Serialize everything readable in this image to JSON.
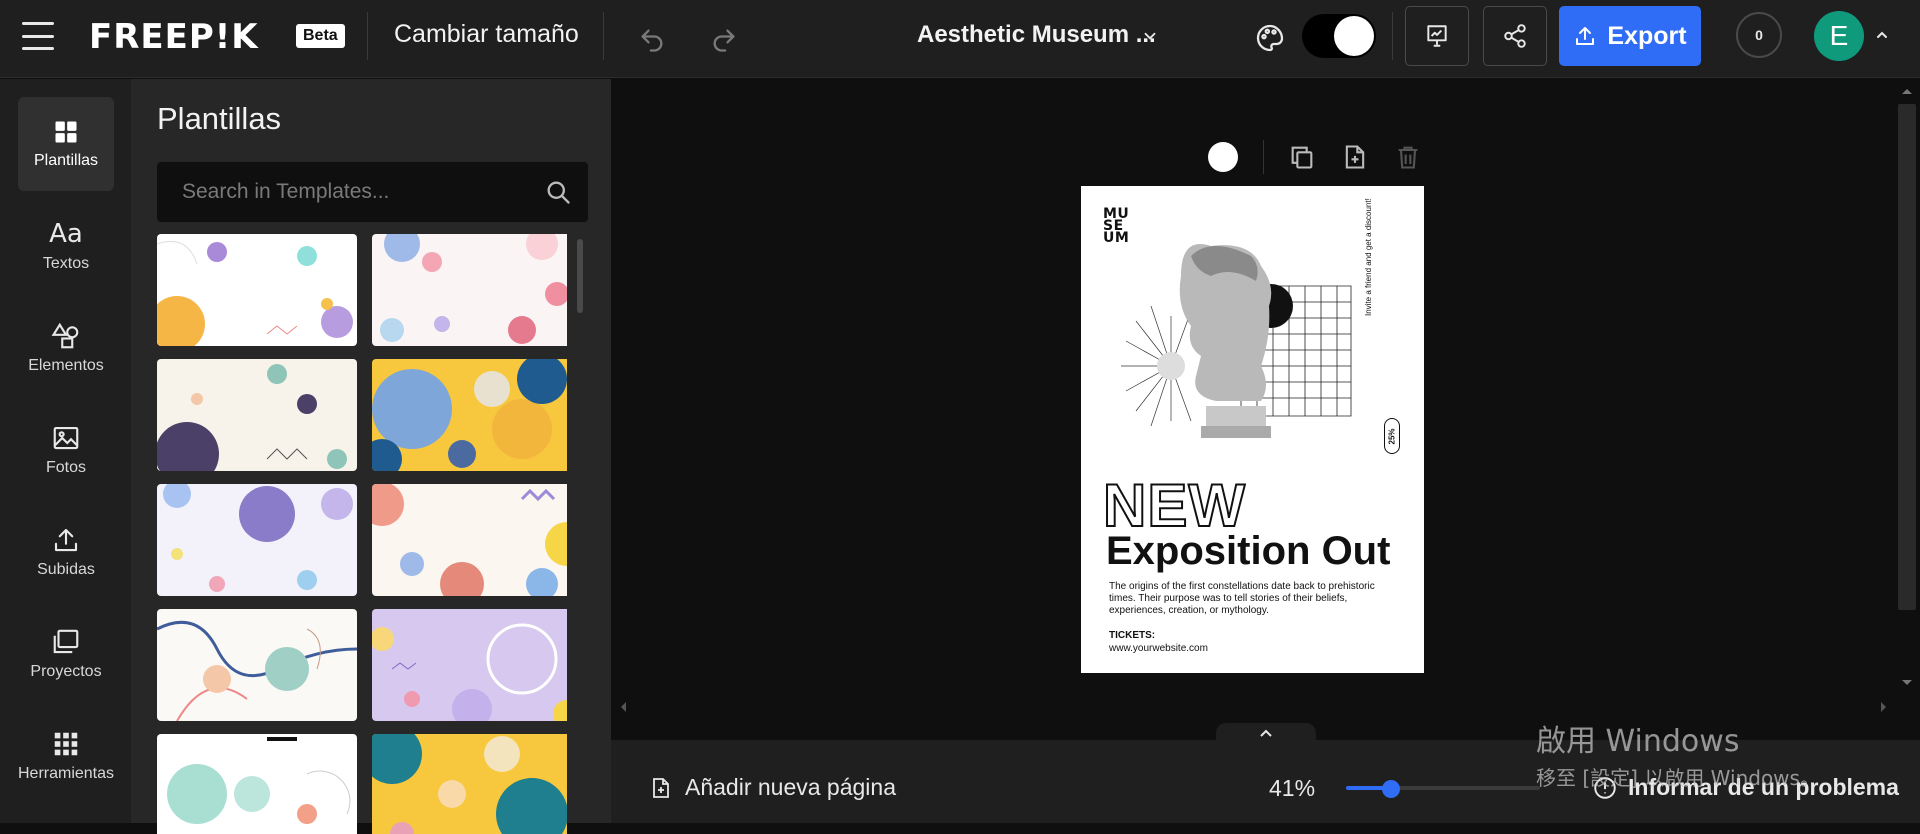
{
  "topbar": {
    "logo": "FREEP!K",
    "beta": "Beta",
    "resize_label": "Cambiar tamaño",
    "doc_title": "Aesthetic Museum ...",
    "export_label": "Export",
    "credits": "0",
    "avatar_initial": "E",
    "accent_color": "#2f6df6",
    "avatar_color": "#0f9a7c"
  },
  "sidebar": {
    "items": [
      {
        "label": "Plantillas",
        "icon": "templates-icon"
      },
      {
        "label": "Textos",
        "icon": "text-icon"
      },
      {
        "label": "Elementos",
        "icon": "elements-icon"
      },
      {
        "label": "Fotos",
        "icon": "photos-icon"
      },
      {
        "label": "Subidas",
        "icon": "upload-icon"
      },
      {
        "label": "Proyectos",
        "icon": "projects-icon"
      },
      {
        "label": "Herramientas",
        "icon": "tools-icon"
      }
    ]
  },
  "panel": {
    "title": "Plantillas",
    "search_placeholder": "Search in Templates..."
  },
  "poster": {
    "museum": "MU\nSE\nUM",
    "side_text": "Invite a friend and get a discount!",
    "badge": "25%",
    "new": "NEW",
    "headline": "Exposition Out",
    "description": "The origins of the first constellations date back to prehistoric times. Their purpose was to tell stories of their beliefs, experiences, creation, or mythology.",
    "tickets": "TICKETS:",
    "website": "www.yourwebsite.com"
  },
  "bottombar": {
    "add_page": "Añadir nueva página",
    "zoom": "41%",
    "zoom_level": 0.23,
    "report": "Informar de un problema"
  },
  "watermark": {
    "line1": "啟用 Windows",
    "line2": "移至 [設定] 以啟用 Windows。"
  }
}
